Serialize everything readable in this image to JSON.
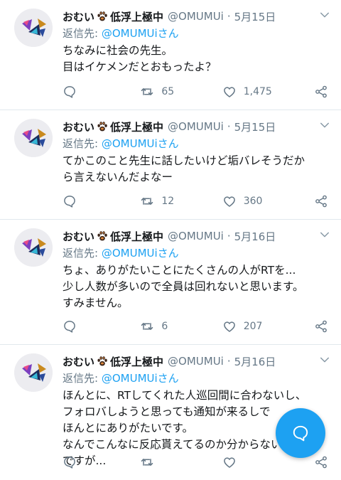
{
  "tweets": [
    {
      "name": "おむい",
      "name_suffix": "低浮上極中",
      "handle": "@OMUMUi",
      "date": "5月15日",
      "reply_prefix": "返信先:",
      "reply_to": "@OMUMUiさん",
      "lines": [
        "ちなみに社会の先生。",
        "目はイケメンだとおもったよ？"
      ],
      "replies": "",
      "retweets": "65",
      "likes": "1,475"
    },
    {
      "name": "おむい",
      "name_suffix": "低浮上極中",
      "handle": "@OMUMUi",
      "date": "5月15日",
      "reply_prefix": "返信先:",
      "reply_to": "@OMUMUiさん",
      "lines": [
        "てかこのこと先生に話したいけど垢バレそうだか",
        "ら言えないんだよなー"
      ],
      "replies": "",
      "retweets": "12",
      "likes": "360"
    },
    {
      "name": "おむい",
      "name_suffix": "低浮上極中",
      "handle": "@OMUMUi",
      "date": "5月16日",
      "reply_prefix": "返信先:",
      "reply_to": "@OMUMUiさん",
      "lines": [
        "ちょ、ありがたいことにたくさんの人がRTを...",
        "少し人数が多いので全員は回れないと思います。",
        "すみません。"
      ],
      "replies": "",
      "retweets": "6",
      "likes": "207"
    },
    {
      "name": "おむい",
      "name_suffix": "低浮上極中",
      "handle": "@OMUMUi",
      "date": "5月16日",
      "reply_prefix": "返信先:",
      "reply_to": "@OMUMUiさん",
      "lines": [
        "ほんとに、RTしてくれた人巡回間に合わないし、",
        "フォロバしようと思っても通知が来るしで",
        "ほんとにありがたいです。",
        "なんでこんなに反応貰えてるのか分からないけど",
        "ですが..."
      ],
      "replies": "",
      "retweets": "",
      "likes": ""
    }
  ],
  "separator": "·",
  "icons": {
    "reply": "reply-icon",
    "retweet": "retweet-icon",
    "like": "heart-icon",
    "share": "share-icon",
    "more": "chevron-down-icon",
    "compose": "compose-reply-icon",
    "paw": "paw-icon"
  },
  "colors": {
    "accent": "#1da1f2",
    "secondary_text": "#657786",
    "divider": "#e1e8ed"
  }
}
